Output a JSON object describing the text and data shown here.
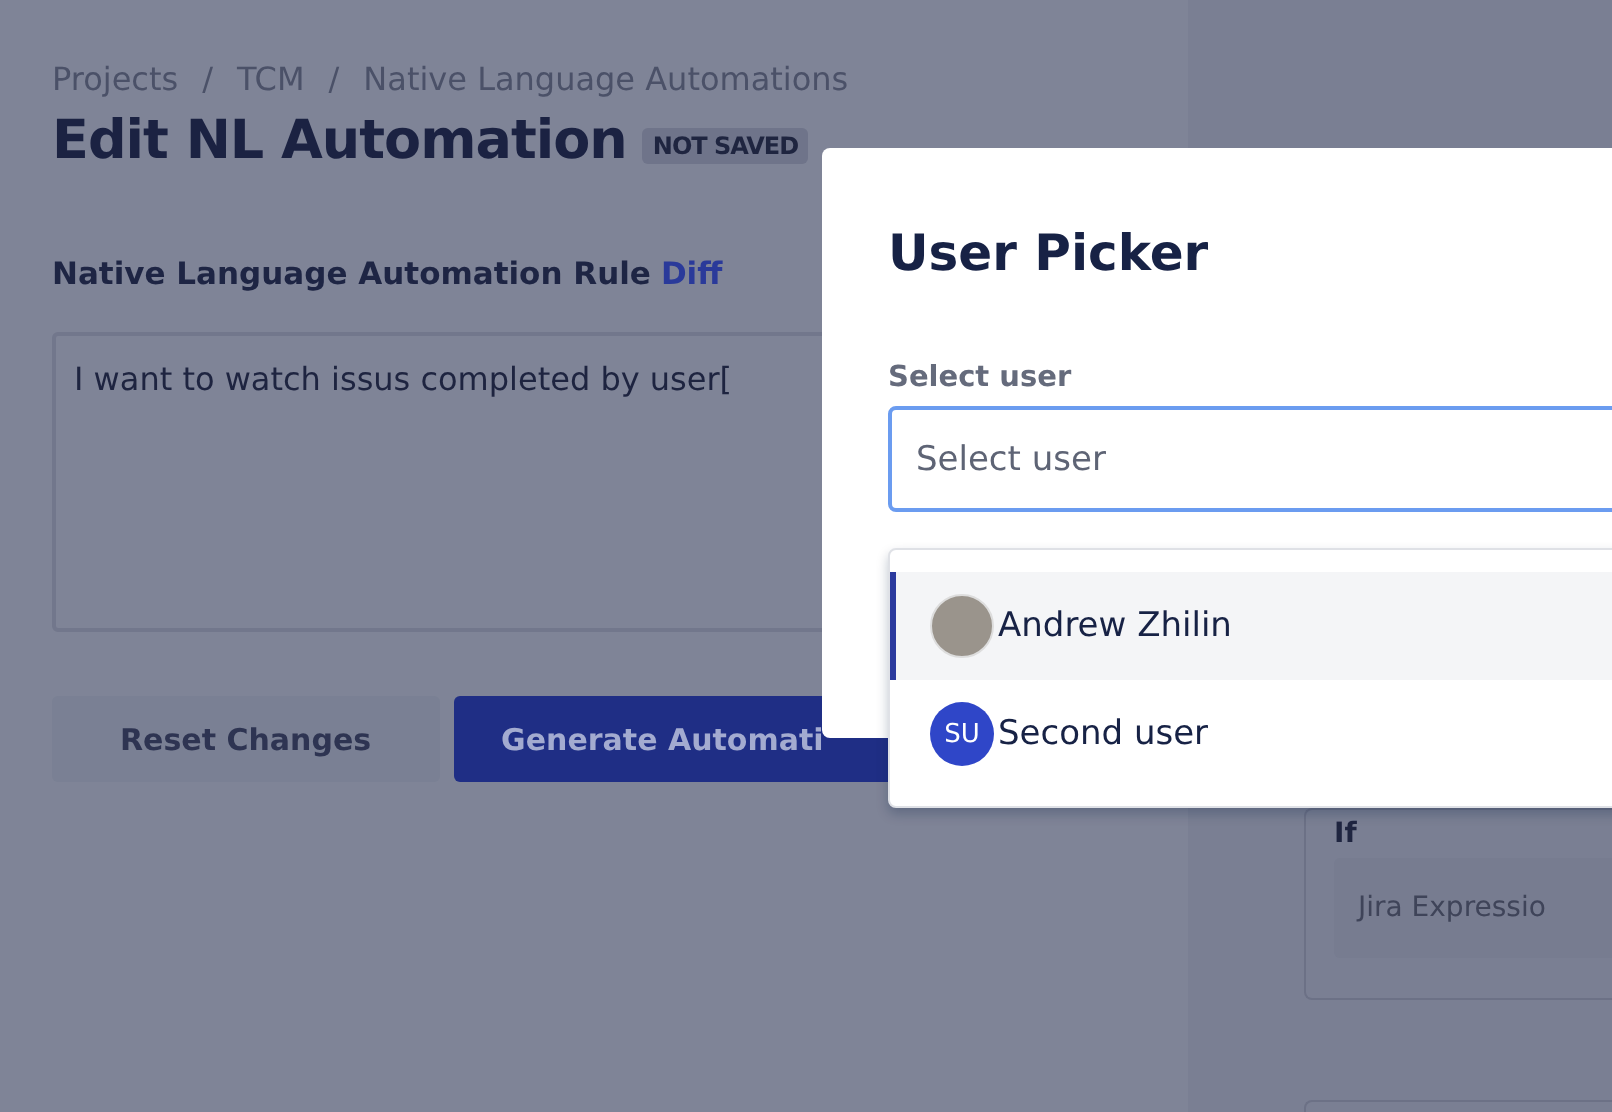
{
  "breadcrumbs": [
    "Projects",
    "TCM",
    "Native Language Automations"
  ],
  "breadcrumb_separator": "/",
  "title": "Edit NL Automation",
  "status_badge": "NOT SAVED",
  "rule": {
    "label": "Native Language Automation Rule",
    "link": "Diff",
    "value": "I want to watch issus completed by user["
  },
  "buttons": [
    {
      "label": "Reset Changes",
      "kind": "secondary"
    },
    {
      "label": "Generate Automati",
      "kind": "primary"
    }
  ],
  "side_panel": {
    "label": "If",
    "placeholder": "Jira Expressio"
  },
  "modal": {
    "title": "User Picker",
    "field_label": "Select user",
    "placeholder": "Select user",
    "options": [
      {
        "name": "Andrew Zhilin",
        "kind": "photo",
        "selected": true
      },
      {
        "name": "Second user",
        "kind": "initials",
        "initials": "SU",
        "selected": false
      }
    ]
  }
}
